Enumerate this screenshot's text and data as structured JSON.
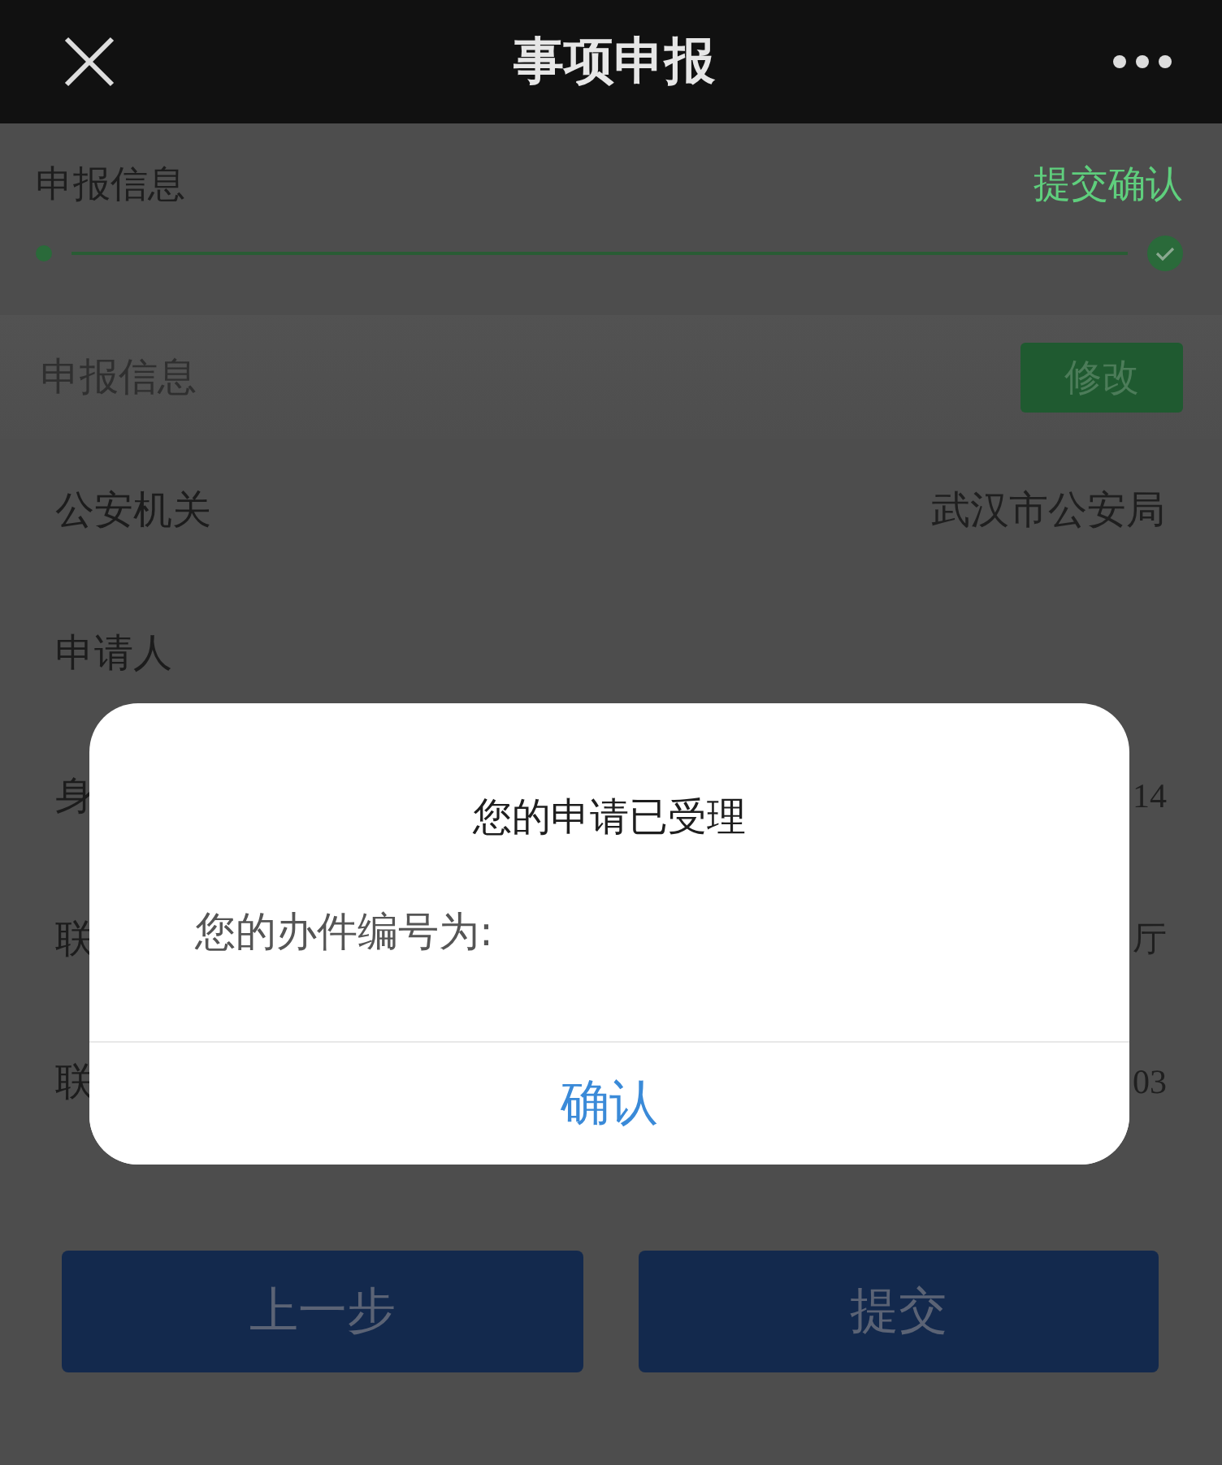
{
  "header": {
    "title": "事项申报"
  },
  "steps": [
    {
      "label": "申报信息",
      "selected": false
    },
    {
      "label": "提交确认",
      "selected": true
    }
  ],
  "section": {
    "title": "申报信息",
    "edit_button": "修改"
  },
  "rows": [
    {
      "label": "公安机关",
      "value": "武汉市公安局"
    },
    {
      "label": "申请人"
    },
    {
      "label": "身",
      "value": "14"
    },
    {
      "label": "联",
      "value": "厅"
    },
    {
      "label": "联",
      "value": "03"
    }
  ],
  "footer_buttons": [
    "上一步",
    "提交"
  ],
  "dialog": {
    "title": "您的申请已受理",
    "message": "您的办件编号为:",
    "confirm": "确认"
  }
}
